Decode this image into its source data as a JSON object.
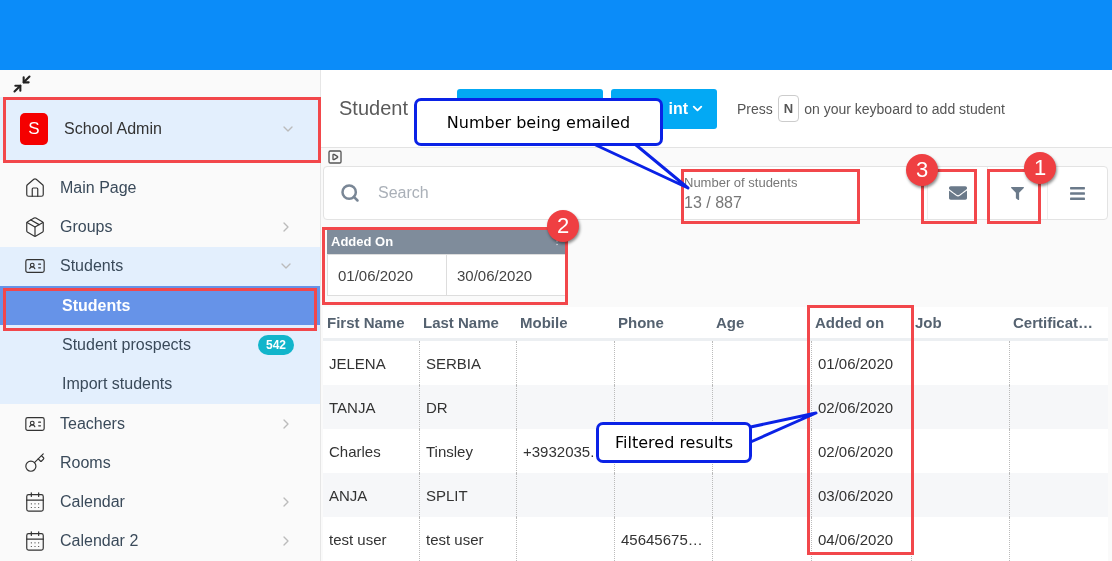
{
  "sidebar": {
    "account": {
      "initial": "S",
      "name": "School Admin"
    },
    "items": [
      {
        "label": "Main Page",
        "kind": "home"
      },
      {
        "label": "Groups",
        "kind": "box",
        "expanded": false
      },
      {
        "label": "Students",
        "kind": "card",
        "expanded": true,
        "children": [
          {
            "label": "Students",
            "selected": true
          },
          {
            "label": "Student prospects",
            "selected": false,
            "badge": "542"
          },
          {
            "label": "Import students",
            "selected": false
          }
        ]
      },
      {
        "label": "Teachers",
        "kind": "card",
        "expanded": false
      },
      {
        "label": "Rooms",
        "kind": "key"
      },
      {
        "label": "Calendar",
        "kind": "calendar",
        "expanded": false
      },
      {
        "label": "Calendar 2",
        "kind": "calendar",
        "expanded": false
      }
    ]
  },
  "header": {
    "title": "Student",
    "print_button": {
      "label": "int"
    },
    "hint": {
      "before": "Press",
      "key": "N",
      "after": "on your keyboard to add student"
    }
  },
  "toolbar": {
    "search": {
      "placeholder": "Search"
    },
    "count": {
      "label": "Number of students",
      "value": "13 / 887"
    }
  },
  "filter": {
    "title": "Added On",
    "from": "01/06/2020",
    "to": "30/06/2020"
  },
  "table": {
    "columns": [
      "First Name",
      "Last Name",
      "Mobile",
      "Phone",
      "Age",
      "Added on",
      "Job",
      "Certificat…"
    ],
    "rows": [
      {
        "cells": [
          "JELENA",
          "SERBIA",
          null,
          null,
          null,
          "01/06/2020",
          null,
          null
        ]
      },
      {
        "cells": [
          "TANJA",
          "DR",
          null,
          null,
          null,
          "02/06/2020",
          null,
          null
        ]
      },
      {
        "cells": [
          "Charles",
          "Tinsley",
          "+3932035.",
          null,
          null,
          "02/06/2020",
          null,
          null
        ]
      },
      {
        "cells": [
          "ANJA",
          "SPLIT",
          null,
          null,
          null,
          "03/06/2020",
          null,
          null
        ]
      },
      {
        "cells": [
          "test user",
          "test user",
          null,
          "45645675…",
          null,
          "04/06/2020",
          null,
          null
        ]
      }
    ]
  },
  "annotations": {
    "callouts": [
      {
        "text": "Number being emailed"
      },
      {
        "text": "Filtered results"
      }
    ],
    "markers": [
      {
        "number": "1"
      },
      {
        "number": "2"
      },
      {
        "number": "3"
      }
    ]
  }
}
